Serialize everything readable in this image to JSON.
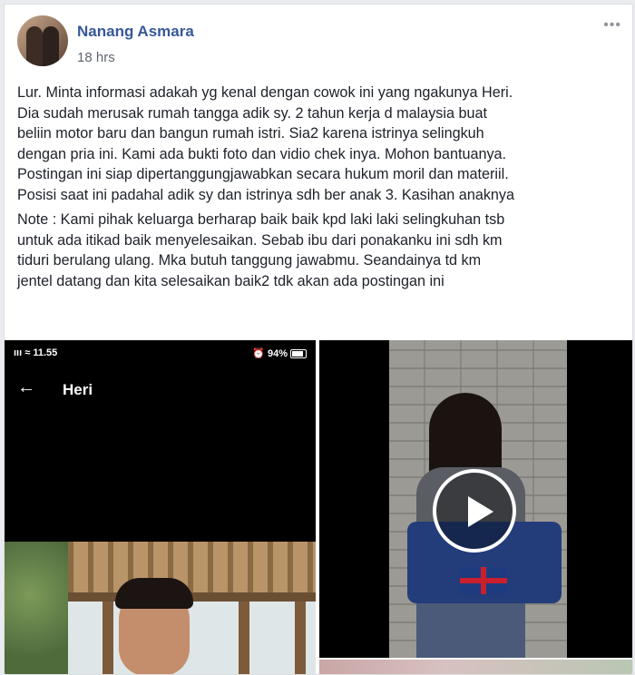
{
  "post": {
    "author": "Nanang Asmara",
    "time": "18 hrs",
    "menu_icon": "ellipsis-icon",
    "paragraphs": [
      [
        "Lur. Minta informasi adakah yg kenal dengan cowok ini yang ngakunya Heri.",
        "Dia sudah merusak rumah tangga adik sy. 2 tahun kerja d malaysia buat",
        "beliin motor baru dan bangun rumah istri. Sia2 karena istrinya selingkuh",
        "dengan pria ini. Kami ada bukti foto dan vidio chek inya. Mohon bantuanya.",
        "Postingan ini siap dipertanggungjawabkan secara hukum moril dan materiil.",
        "Posisi saat ini padahal adik sy dan istrinya sdh ber anak 3. Kasihan anaknya"
      ],
      [
        "Note : Kami pihak keluarga berharap baik baik kpd laki laki selingkuhan tsb",
        "untuk ada itikad baik menyelesaikan. Sebab ibu dari ponakanku ini sdh km",
        "tiduri berulang ulang. Mka butuh tanggung jawabmu. Seandainya td km",
        "jentel datang dan kita selesaikan baik2 tdk akan ada postingan ini"
      ]
    ]
  },
  "screenshot": {
    "status_time": "11.55",
    "status_right": "94%",
    "contact_name": "Heri",
    "back_icon": "back-arrow-icon"
  },
  "video": {
    "play_icon": "play-icon"
  }
}
